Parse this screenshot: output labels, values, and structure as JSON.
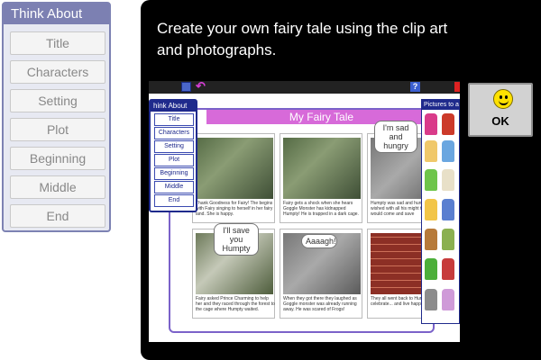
{
  "left_panel": {
    "title": "Think About",
    "buttons": [
      "Title",
      "Characters",
      "Setting",
      "Plot",
      "Beginning",
      "Middle",
      "End"
    ]
  },
  "instruction": "Create your own fairy tale using the clip art and photographs.",
  "embedded": {
    "toolbar": {
      "help_label": "?"
    },
    "book_title": "My Fairy Tale",
    "think_menu": {
      "title": "hink About",
      "buttons": [
        "Title",
        "Characters",
        "Setting",
        "Plot",
        "Beginning",
        "Middle",
        "End"
      ]
    },
    "pictures_title": "Pictures to a",
    "cells": [
      {
        "caption": "Thank Goodness for Fairy! The begins with Fairy singing to herself in her fairy land. She is happy."
      },
      {
        "caption": "Fairy gets a shock when she hears Goggle Monster has kidnapped Humpty! He is trapped in a dark cage."
      },
      {
        "caption": "Humpty was sad and hungry. He wished with all his might that someone would come and save"
      },
      {
        "caption": "Fairy asked Prince Charming to help her and they raced through the forest to the cage where Humpty waited."
      },
      {
        "caption": "When they got there they laughed as Goggle monster was already running away. He was scared of Frogs!"
      },
      {
        "caption": "They all went back to Hum the castle to celebrate... and live happily ever after!"
      }
    ],
    "bubbles": {
      "sad": "I'm sad and hungry",
      "save": "I'll save you Humpty",
      "aaagh": "Aaaagh!"
    }
  },
  "ok_button": {
    "label": "OK"
  },
  "colors": {
    "panel_header": "#7c80b2",
    "book_title_bg": "#d76ad9",
    "menu_blue": "#1f2a8c",
    "smiley": "#ffe100"
  }
}
